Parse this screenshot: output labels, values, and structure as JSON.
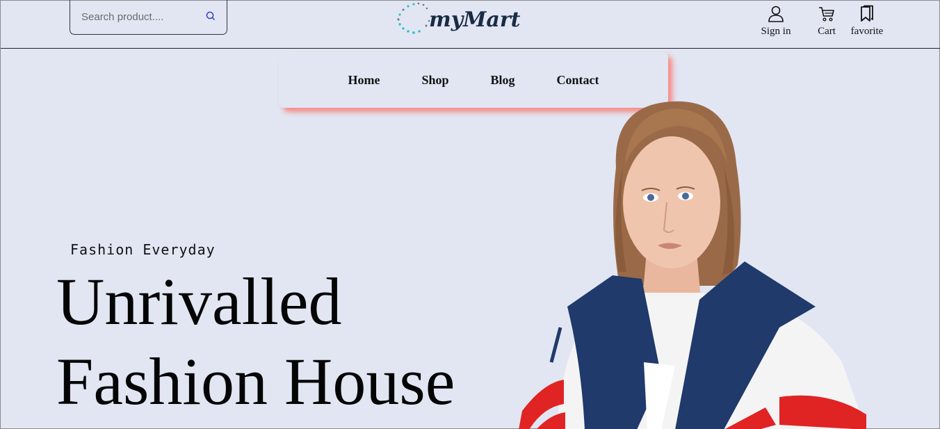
{
  "search": {
    "placeholder": "Search product....",
    "icon": "search-icon"
  },
  "brand": {
    "name": "myMart",
    "logo_color": "#1a2b45",
    "dots_colors": [
      "#2ec4c4",
      "#6b7a8f"
    ]
  },
  "header": {
    "actions": [
      {
        "icon": "user-icon",
        "label": "Sign in"
      },
      {
        "icon": "cart-icon",
        "label": "Cart"
      },
      {
        "icon": "bookmark-icon",
        "label": "favorite"
      }
    ]
  },
  "nav": {
    "items": [
      "Home",
      "Shop",
      "Blog",
      "Contact"
    ],
    "shadow_color": "#fa786e"
  },
  "hero": {
    "eyebrow": "Fashion Everyday",
    "headline_line1": "Unrivalled",
    "headline_line2": "Fashion House",
    "image": "model-in-navy-white-red-jacket"
  },
  "colors": {
    "background": "#e2e6f3",
    "text": "#111111"
  }
}
